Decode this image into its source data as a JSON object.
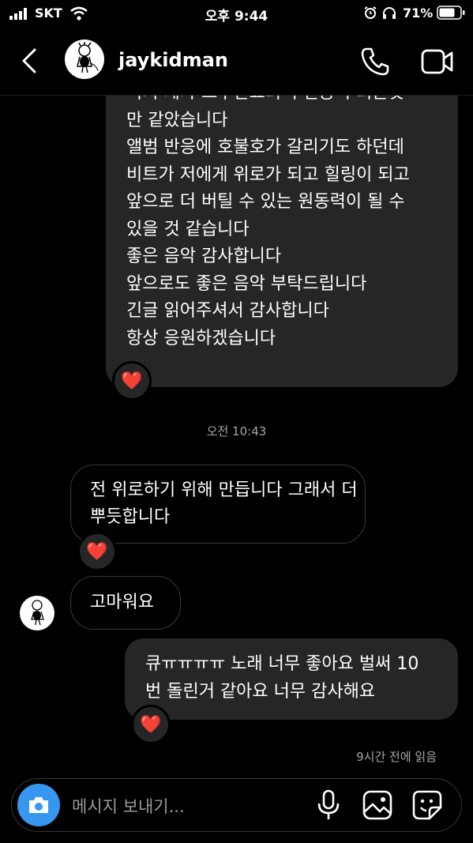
{
  "status_bar": {
    "carrier": "SKT",
    "time": "오후 9:44",
    "battery": "71%"
  },
  "header": {
    "username": "jaykidman"
  },
  "messages": {
    "top_received_lines": [
      "비치 제가 트루만쇼의 주인공이 되는것",
      "만 같았습니다",
      "앨범 반응에 호불호가 갈리기도 하던데",
      "비트가 저에게 위로가 되고 힐링이 되고",
      "앞으로 더 버틸 수 있는 원동력이 될 수",
      "있을 것 같습니다",
      "좋은 음악 감사합니다",
      "앞으로도 좋은 음악 부탁드립니다",
      "긴글 읽어주셔서 감사합니다",
      "항상 응원하겠습니다"
    ],
    "timestamp": "오전 10:43",
    "reply1_lines": [
      "전 위로하기 위해 만듭니다 그래서 더",
      "뿌듯합니다"
    ],
    "reply2": "고마워요",
    "sent_lines": [
      "큐ㅠㅠㅠㅠ 노래 너무 좋아요 벌써 10",
      "번 돌린거 같아요 너무 감사해요"
    ],
    "read_receipt": "9시간 전에 읽음",
    "reaction": "❤️"
  },
  "composer": {
    "placeholder": "메시지 보내기..."
  },
  "colors": {
    "bubble": "#262626",
    "accent": "#3797f0",
    "heart": "#ed1c24"
  }
}
